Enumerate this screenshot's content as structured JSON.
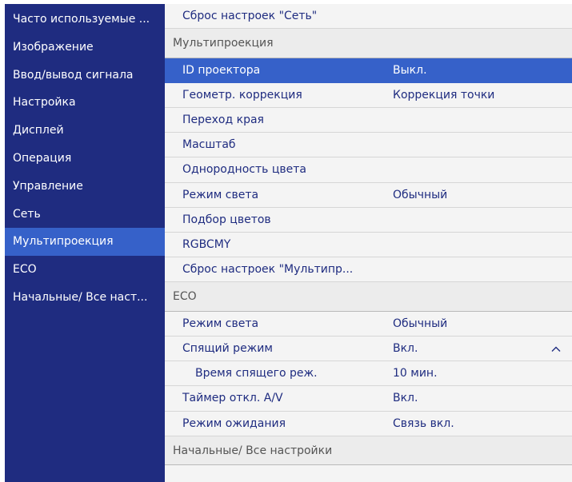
{
  "sidebar": {
    "items": [
      {
        "label": "Часто используемые ...",
        "active": false
      },
      {
        "label": "Изображение",
        "active": false
      },
      {
        "label": "Ввод/вывод сигнала",
        "active": false
      },
      {
        "label": "Настройка",
        "active": false
      },
      {
        "label": "Дисплей",
        "active": false
      },
      {
        "label": "Операция",
        "active": false
      },
      {
        "label": "Управление",
        "active": false
      },
      {
        "label": "Сеть",
        "active": false
      },
      {
        "label": "Мультипроекция",
        "active": true
      },
      {
        "label": "ECO",
        "active": false
      },
      {
        "label": "Начальные/ Все наст...",
        "active": false
      }
    ]
  },
  "main": {
    "network_reset": "Сброс настроек \"Сеть\"",
    "multiprojection": {
      "header": "Мультипроекция",
      "rows": [
        {
          "label": "ID проектора",
          "value": "Выкл."
        },
        {
          "label": "Геометр. коррекция",
          "value": "Коррекция точки"
        },
        {
          "label": "Переход края",
          "value": ""
        },
        {
          "label": "Масштаб",
          "value": ""
        },
        {
          "label": "Однородность цвета",
          "value": ""
        },
        {
          "label": "Режим света",
          "value": "Обычный"
        },
        {
          "label": "Подбор цветов",
          "value": ""
        },
        {
          "label": "RGBCMY",
          "value": ""
        },
        {
          "label": "Сброс настроек \"Мультипр...",
          "value": ""
        }
      ]
    },
    "eco": {
      "header": "ECO",
      "rows": [
        {
          "label": "Режим света",
          "value": "Обычный"
        },
        {
          "label": "Спящий режим",
          "value": "Вкл."
        },
        {
          "label": "Время спящего реж.",
          "value": "10 мин."
        },
        {
          "label": "Таймер откл. A/V",
          "value": "Вкл."
        },
        {
          "label": "Режим ожидания",
          "value": "Связь вкл."
        }
      ]
    },
    "initial_header": "Начальные/ Все настройки"
  },
  "colors": {
    "sidebar_bg": "#1f2c80",
    "highlight": "#3661c9",
    "text_primary": "#1f2c80",
    "background": "#f4f4f4"
  }
}
